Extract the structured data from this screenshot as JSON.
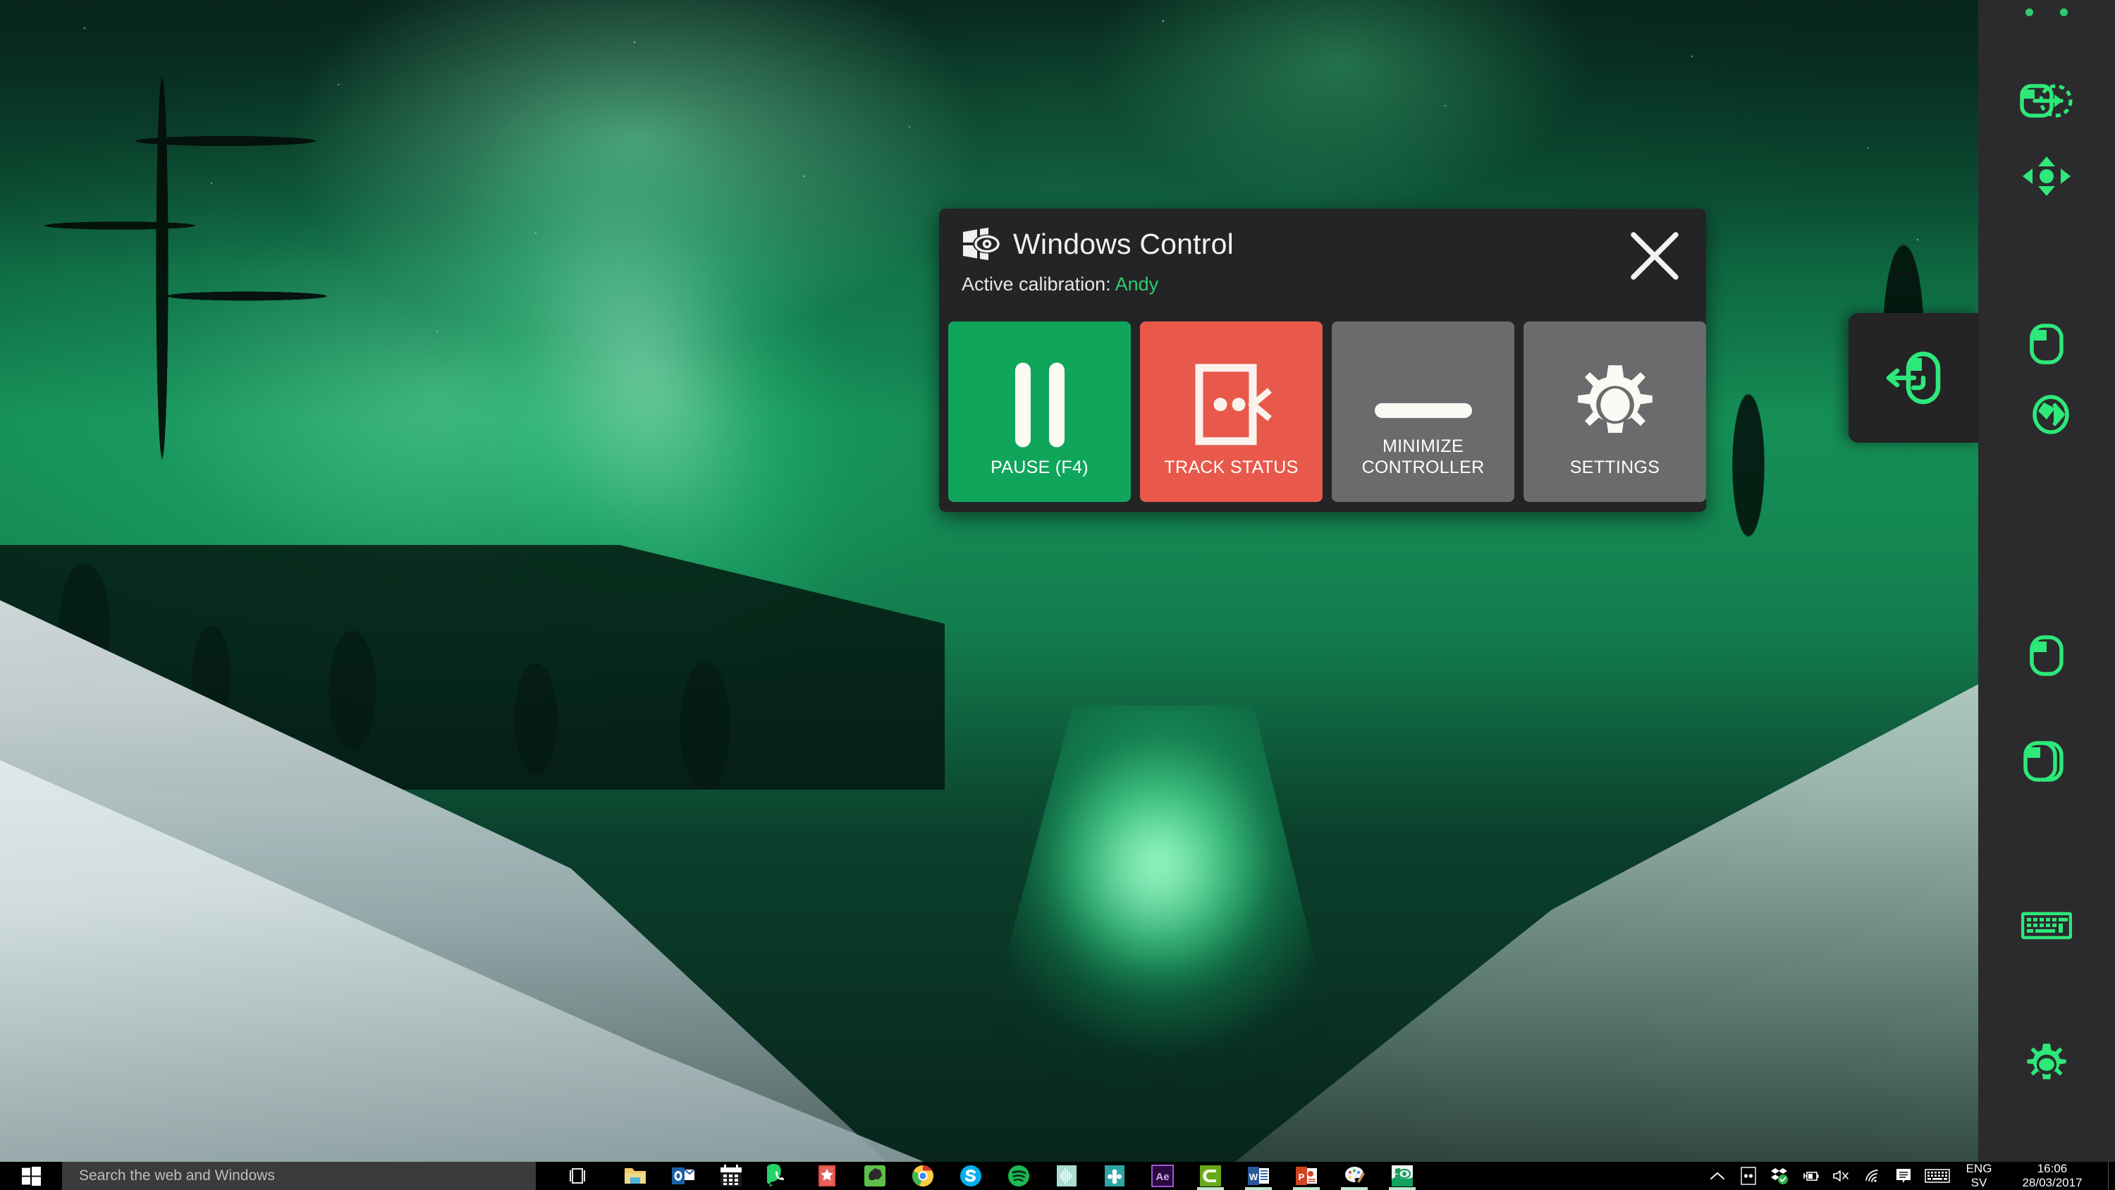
{
  "desktop": {
    "wallpaper_name": "aurora-borealis-winter-river-wallpaper",
    "accent_green": "#2ecc71",
    "sidebar_bg": "#2b2b2d"
  },
  "windows_control": {
    "app_icon": "windows-eye-logo-icon",
    "title": "Windows Control",
    "close_label": "✕",
    "calibration_label": "Active calibration:",
    "calibration_value": "Andy",
    "buttons": [
      {
        "id": "pause",
        "label": "PAUSE (F4)",
        "icon": "pause-icon",
        "color": "#0fa65c"
      },
      {
        "id": "track",
        "label": "TRACK STATUS",
        "icon": "track-status-icon",
        "color": "#e8594b"
      },
      {
        "id": "minimize",
        "label": "MINIMIZE\nCONTROLLER",
        "icon": "minimize-icon",
        "color": "#6b6b6e"
      },
      {
        "id": "settings",
        "label": "SETTINGS",
        "icon": "gear-icon",
        "color": "#6b6b6e"
      }
    ],
    "minimize_line1": "MINIMIZE",
    "minimize_line2": "CONTROLLER"
  },
  "hint_panel": {
    "icon": "mouse-scroll-back-icon"
  },
  "sidebar": {
    "status_dots": 2,
    "items": [
      {
        "id": "zoom-select",
        "icon": "zoom-to-select-icon"
      },
      {
        "id": "precise-cursor",
        "icon": "pan-arrows-icon"
      },
      {
        "id": "left-click",
        "icon": "mouse-left-click-icon"
      },
      {
        "id": "drag-drop",
        "icon": "drag-and-drop-icon"
      },
      {
        "id": "double-click",
        "icon": "mouse-double-click-icon"
      },
      {
        "id": "keyboard",
        "icon": "keyboard-icon"
      },
      {
        "id": "settings",
        "icon": "gear-icon"
      }
    ]
  },
  "taskbar": {
    "start_icon": "windows-start-icon",
    "search_placeholder": "Search the web and Windows",
    "search_value": "",
    "task_view_icon": "task-view-icon",
    "pinned_apps": [
      {
        "name": "File Explorer",
        "icon": "file-explorer-icon",
        "running": false
      },
      {
        "name": "Outlook",
        "icon": "outlook-icon",
        "running": false
      },
      {
        "name": "Calendar",
        "icon": "calendar-icon",
        "running": false
      },
      {
        "name": "WhatsApp",
        "icon": "whatsapp-icon",
        "running": false
      },
      {
        "name": "Wunderlist",
        "icon": "wunderlist-icon",
        "running": false
      },
      {
        "name": "Evernote",
        "icon": "evernote-icon",
        "running": false
      },
      {
        "name": "Google Chrome",
        "icon": "chrome-icon",
        "running": false
      },
      {
        "name": "Skype",
        "icon": "skype-icon",
        "running": false
      },
      {
        "name": "Spotify",
        "icon": "spotify-icon",
        "running": false
      },
      {
        "name": "Audacity",
        "icon": "audio-waveform-icon",
        "running": false
      },
      {
        "name": "Sound App",
        "icon": "teal-plus-icon",
        "running": false
      },
      {
        "name": "After Effects",
        "icon": "after-effects-icon",
        "running": false
      },
      {
        "name": "Camtasia",
        "icon": "camtasia-icon",
        "running": true
      },
      {
        "name": "Word",
        "icon": "word-icon",
        "running": true
      },
      {
        "name": "PowerPoint",
        "icon": "powerpoint-icon",
        "running": true
      },
      {
        "name": "Paint",
        "icon": "paint-icon",
        "running": true
      },
      {
        "name": "Windows Control",
        "icon": "windows-control-icon",
        "running": true
      }
    ],
    "tray": [
      {
        "name": "show-hidden-icons",
        "icon": "chevron-up-icon"
      },
      {
        "name": "eye-tracker",
        "icon": "eye-tracker-icon"
      },
      {
        "name": "dropbox",
        "icon": "dropbox-check-icon"
      },
      {
        "name": "battery",
        "icon": "battery-charging-icon"
      },
      {
        "name": "volume",
        "icon": "volume-muted-icon"
      },
      {
        "name": "network",
        "icon": "wifi-icon"
      },
      {
        "name": "action-center",
        "icon": "action-center-icon"
      },
      {
        "name": "touch-keyboard",
        "icon": "keyboard-icon"
      }
    ],
    "language_line1": "ENG",
    "language_line2": "SV",
    "clock_time": "16:06",
    "clock_date": "28/03/2017"
  }
}
